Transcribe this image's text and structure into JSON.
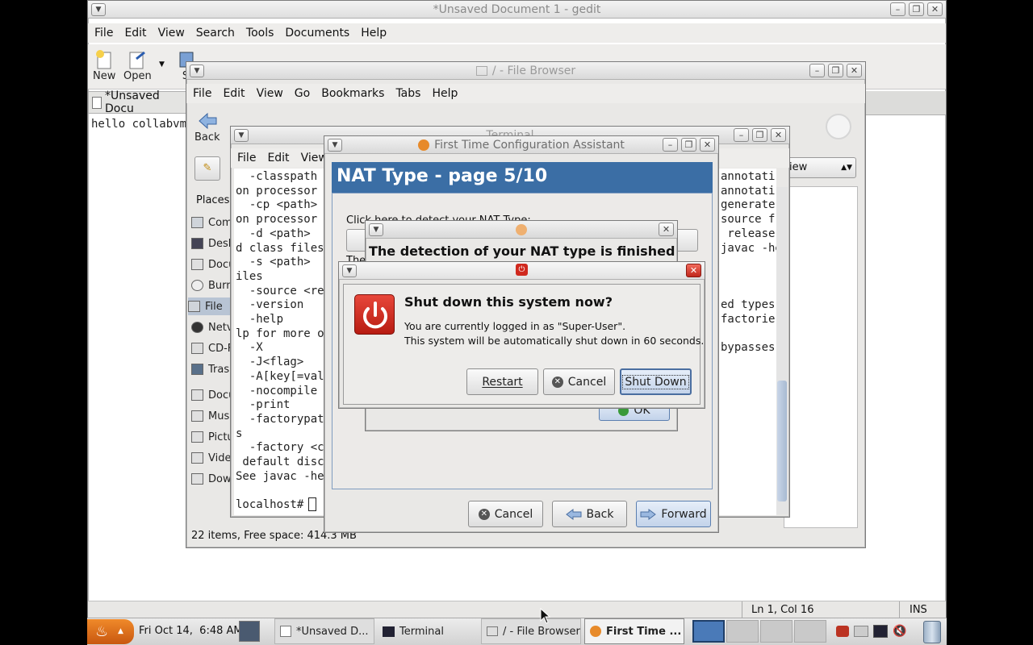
{
  "gedit": {
    "title": "*Unsaved Document 1 - gedit",
    "menu": [
      "File",
      "Edit",
      "View",
      "Search",
      "Tools",
      "Documents",
      "Help"
    ],
    "toolbar": {
      "new_label": "New",
      "open_label": "Open",
      "save_partial": "S"
    },
    "tab_label": "*Unsaved Docu",
    "content": "hello collabvm",
    "status": {
      "position": "Ln 1, Col 16",
      "mode": "INS"
    }
  },
  "file_browser": {
    "title": "/ - File Browser",
    "menu": [
      "File",
      "Edit",
      "View",
      "Go",
      "Bookmarks",
      "Tabs",
      "Help"
    ],
    "back_label": "Back",
    "places_label": "Places",
    "places": [
      "Com",
      "Desk",
      "Docu",
      "Burn",
      "File",
      "Netv",
      "CD-F",
      "Trasl",
      "Docu",
      "Musi",
      "Pictu",
      "Vide",
      "Dow"
    ],
    "view_select": "iew",
    "status": "22 items, Free space: 414.3 MB"
  },
  "terminal": {
    "title": "Terminal",
    "menu": [
      "File",
      "Edit",
      "View"
    ],
    "lines": [
      "  -classpath",
      "on processor",
      "  -cp <path>",
      "on processor",
      "  -d <path>",
      "d class files",
      "  -s <path>",
      "iles",
      "  -source <re",
      "  -version",
      "  -help",
      "lp for more o",
      "  -X",
      "  -J<flag>",
      "  -A[key[=val",
      "  -nocompile",
      "  -print",
      "  -factorypat",
      "s",
      "  -factory <c",
      " default disc",
      "See javac -he",
      "",
      "localhost# "
    ],
    "right_lines": [
      "annotati",
      "annotati",
      "generate",
      "source f",
      " release",
      "javac -he",
      "",
      "",
      "",
      "ed types",
      "factorie",
      "",
      "bypasses"
    ]
  },
  "assistant": {
    "title": "First Time Configuration Assistant",
    "header": "NAT Type - page 5/10",
    "detect_text": "Click here to detect your NAT Type:",
    "partial_text": "The",
    "cancel_label": "Cancel",
    "back_label": "Back",
    "forward_label": "Forward"
  },
  "nat_dialog": {
    "message": "The detection of your NAT type is finished",
    "ok_label": "OK"
  },
  "shutdown": {
    "heading": "Shut down this system now?",
    "line1": "You are currently logged in as \"Super-User\".",
    "line2": "This system will be automatically shut down in 60 seconds.",
    "restart_label": "Restart",
    "cancel_label": "Cancel",
    "shutdown_label": "Shut Down"
  },
  "taskbar": {
    "clock": "Fri Oct 14,  6:48 AM",
    "items": [
      "*Unsaved D...",
      "Terminal",
      "/ - File Browser",
      "First Time ..."
    ]
  },
  "colors": {
    "assistant_header": "#3b6ea5",
    "shutdown_red": "#d0291e",
    "accent": "#4a7ab8"
  }
}
